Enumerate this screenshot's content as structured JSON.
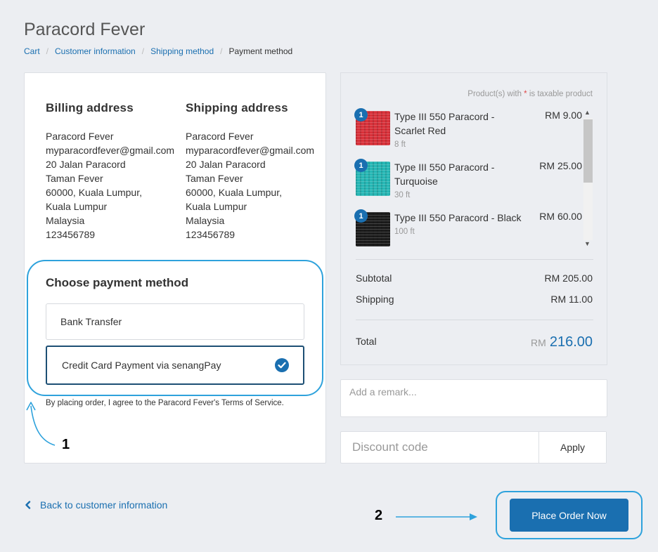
{
  "store": {
    "title": "Paracord Fever"
  },
  "breadcrumb": {
    "cart": "Cart",
    "customer_information": "Customer information",
    "shipping_method": "Shipping method",
    "payment_method": "Payment method"
  },
  "billing": {
    "heading": "Billing address",
    "lines": [
      "Paracord Fever",
      "myparacordfever@gmail.com",
      "20 Jalan Paracord",
      "Taman Fever",
      "60000, Kuala Lumpur,",
      "Kuala Lumpur",
      "Malaysia",
      "123456789"
    ]
  },
  "shipping": {
    "heading": "Shipping address",
    "lines": [
      "Paracord Fever",
      "myparacordfever@gmail.com",
      "20 Jalan Paracord",
      "Taman Fever",
      "60000, Kuala Lumpur,",
      "Kuala Lumpur",
      "Malaysia",
      "123456789"
    ]
  },
  "payment": {
    "heading": "Choose payment method",
    "options": [
      {
        "label": "Bank Transfer",
        "selected": false
      },
      {
        "label": "Credit Card Payment via senangPay",
        "selected": true
      }
    ],
    "terms": "By placing order, I agree to the Paracord Fever's Terms of Service."
  },
  "summary": {
    "taxable_note_prefix": "Product(s) with ",
    "taxable_note_star": "*",
    "taxable_note_suffix": " is taxable product",
    "products": [
      {
        "qty": "1",
        "name": "Type III 550 Paracord - Scarlet Red",
        "variant": "8 ft",
        "price": "RM 9.00",
        "color": "#d9313a"
      },
      {
        "qty": "1",
        "name": "Type III 550 Paracord - Turquoise",
        "variant": "30 ft",
        "price": "RM 25.00",
        "color": "#26b7b5"
      },
      {
        "qty": "1",
        "name": "Type III 550 Paracord - Black",
        "variant": "100 ft",
        "price": "RM 60.00",
        "color": "#1b1b1b"
      }
    ],
    "subtotal_label": "Subtotal",
    "subtotal_value": "RM 205.00",
    "shipping_label": "Shipping",
    "shipping_value": "RM 11.00",
    "total_label": "Total",
    "total_currency": "RM",
    "total_amount": "216.00"
  },
  "remark": {
    "placeholder": "Add a remark..."
  },
  "discount": {
    "placeholder": "Discount code",
    "apply_label": "Apply"
  },
  "footer": {
    "back_label": "Back to customer information",
    "place_order_label": "Place Order Now"
  },
  "annotations": {
    "one": "1",
    "two": "2"
  },
  "colors": {
    "accent": "#1a6fb0",
    "highlight": "#2ea2dc",
    "selected_border": "#1d4f74"
  }
}
